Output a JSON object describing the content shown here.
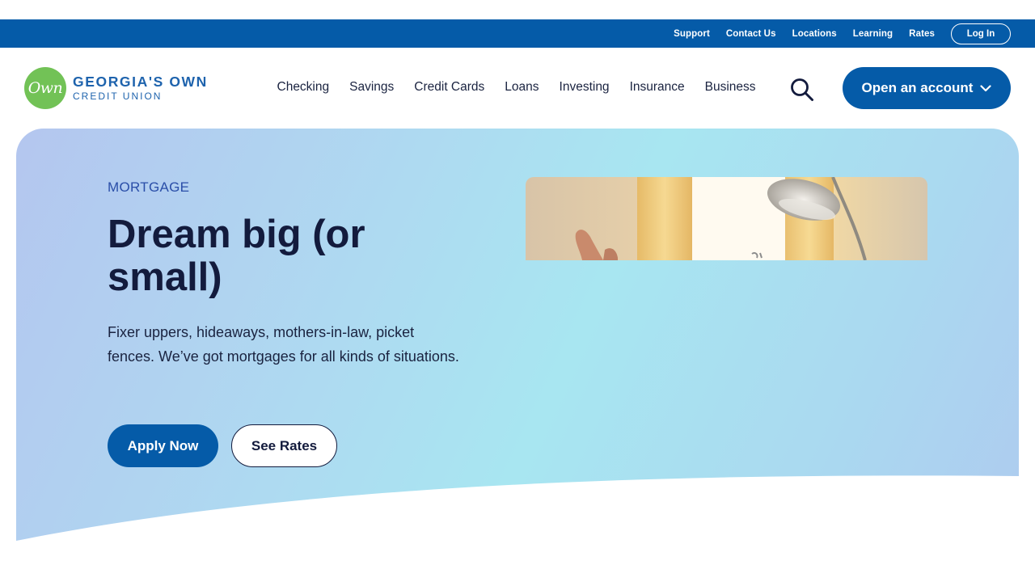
{
  "utility_nav": {
    "links": [
      "Support",
      "Contact Us",
      "Locations",
      "Learning",
      "Rates"
    ],
    "login_label": "Log In"
  },
  "brand": {
    "logo_mark": "Own",
    "name_line1": "GEORGIA'S OWN",
    "name_line2": "CREDIT UNION",
    "green": "#72c256",
    "blue": "#055ba8"
  },
  "main_nav": {
    "items": [
      "Checking",
      "Savings",
      "Credit Cards",
      "Loans",
      "Investing",
      "Insurance",
      "Business"
    ],
    "search_icon": "search-icon",
    "cta_label": "Open an account",
    "cta_icon": "chevron-down-icon"
  },
  "hero": {
    "eyebrow": "MORTGAGE",
    "title": "Dream big (or small)",
    "description": "Fixer uppers, hideaways, mothers-in-law, picket fences. We’ve got mortgages for all kinds of situations.",
    "primary_button": "Apply Now",
    "secondary_button": "See Rates"
  }
}
